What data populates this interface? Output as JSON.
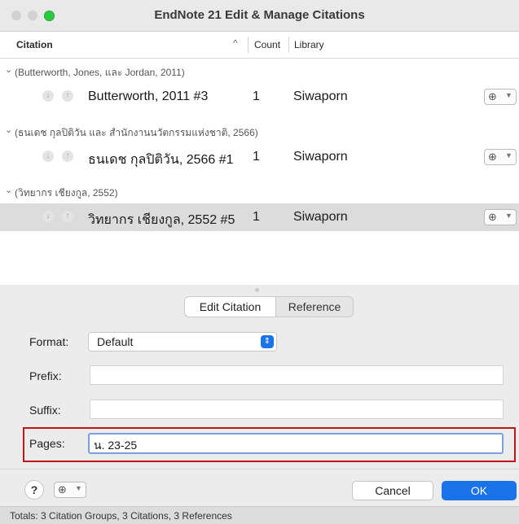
{
  "window": {
    "title": "EndNote 21 Edit & Manage Citations"
  },
  "columns": {
    "citation": "Citation",
    "sort_indicator": "^",
    "count": "Count",
    "library": "Library"
  },
  "groups": [
    {
      "header": "(Butterworth, Jones, และ Jordan, 2011)",
      "row": {
        "citation": "Butterworth, 2011 #3",
        "count": "1",
        "library": "Siwaporn",
        "selected": false
      }
    },
    {
      "header": "(ธนเดช กุลปิติวัน และ สำนักงานนวัตกรรมแห่งชาติ, 2566)",
      "row": {
        "citation": "ธนเดช กุลปิติวัน, 2566 #1",
        "count": "1",
        "library": "Siwaporn",
        "selected": false
      }
    },
    {
      "header": "(วิทยากร เชียงกูล, 2552)",
      "row": {
        "citation": "วิทยากร เชียงกูล, 2552 #5",
        "count": "1",
        "library": "Siwaporn",
        "selected": true
      }
    }
  ],
  "tabs": {
    "edit_citation": "Edit Citation",
    "reference": "Reference",
    "active": "Edit Citation"
  },
  "form": {
    "format_label": "Format:",
    "format_value": "Default",
    "prefix_label": "Prefix:",
    "prefix_value": "",
    "suffix_label": "Suffix:",
    "suffix_value": "",
    "pages_label": "Pages:",
    "pages_value": "น. 23-25"
  },
  "footer": {
    "help_label": "?",
    "cancel_label": "Cancel",
    "ok_label": "OK"
  },
  "status": {
    "text": "Totals: 3 Citation Groups, 3 Citations, 3 References"
  },
  "colors": {
    "accent": "#1a73e8",
    "highlight_box": "#c0141c",
    "selected_row": "#dcdcdc"
  },
  "icons": {
    "row_down": "arrow-down-icon",
    "row_up": "arrow-up-icon",
    "row_menu": "ellipsis-menu-icon",
    "group_toggle": "chevron-down-icon"
  }
}
